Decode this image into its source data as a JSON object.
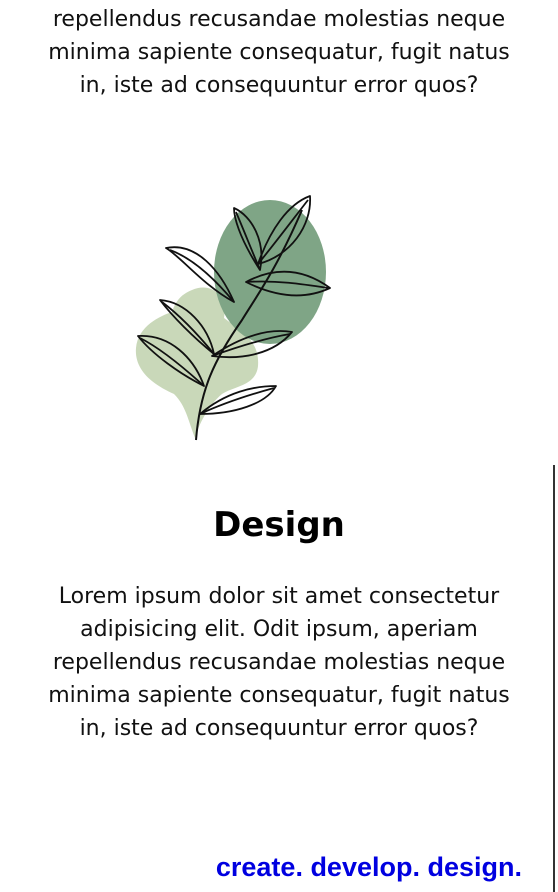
{
  "top_paragraph": {
    "lines": [
      "repellendus recusandae molestias neque",
      "minima sapiente consequatur, fugit natus",
      "in, iste ad consequuntur error quos?"
    ]
  },
  "illustration": {
    "icon": "leaf-branch-icon",
    "colors": {
      "dark_blob": "#7fa586",
      "light_blob": "#c9d8b9",
      "outline": "#111111"
    }
  },
  "design_section": {
    "title": "Design",
    "lines": [
      "Lorem ipsum dolor sit amet consectetur",
      "adipisicing elit. Odit ipsum, aperiam",
      "repellendus recusandae molestias neque",
      "minima sapiente consequatur, fugit natus",
      "in, iste ad consequuntur error quos?"
    ]
  },
  "tagline": {
    "text": "create. develop. design.",
    "color": "#0000e0"
  }
}
